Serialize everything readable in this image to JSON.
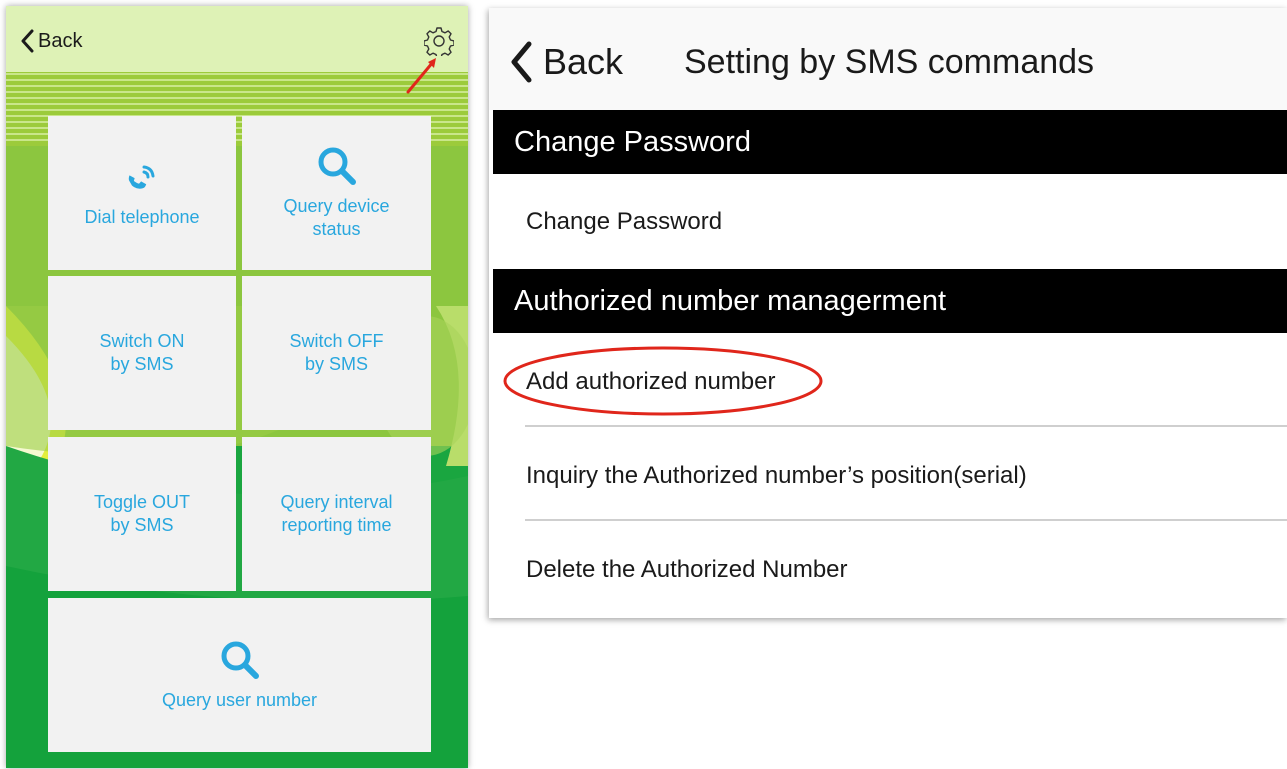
{
  "phone": {
    "back_label": "Back",
    "tiles": [
      {
        "label": "Dial telephone",
        "icon": "phone-icon"
      },
      {
        "label": "Query device\nstatus",
        "icon": "search-icon"
      },
      {
        "label": "Switch ON\nby SMS",
        "icon": ""
      },
      {
        "label": "Switch OFF\nby SMS",
        "icon": ""
      },
      {
        "label": "Toggle OUT\nby SMS",
        "icon": ""
      },
      {
        "label": "Query interval\nreporting time",
        "icon": ""
      },
      {
        "label": "Query user number",
        "icon": "search-icon"
      }
    ],
    "colors": {
      "accent_text": "#29a7de",
      "tile_bg": "#f2f2f2",
      "header_bg": "#def2b6",
      "background_green": "#1aa640",
      "annotation_arrow": "#e0261b"
    }
  },
  "settings": {
    "back_label": "Back",
    "title": "Setting by SMS commands",
    "sections": [
      {
        "header": "Change Password",
        "rows": [
          "Change Password"
        ]
      },
      {
        "header": "Authorized number managerment",
        "rows": [
          "Add authorized number",
          "Inquiry the Authorized number’s position(serial)",
          "Delete the Authorized Number"
        ]
      }
    ],
    "colors": {
      "section_header_bg": "#000000",
      "highlight_ellipse": "#e0261b"
    }
  }
}
